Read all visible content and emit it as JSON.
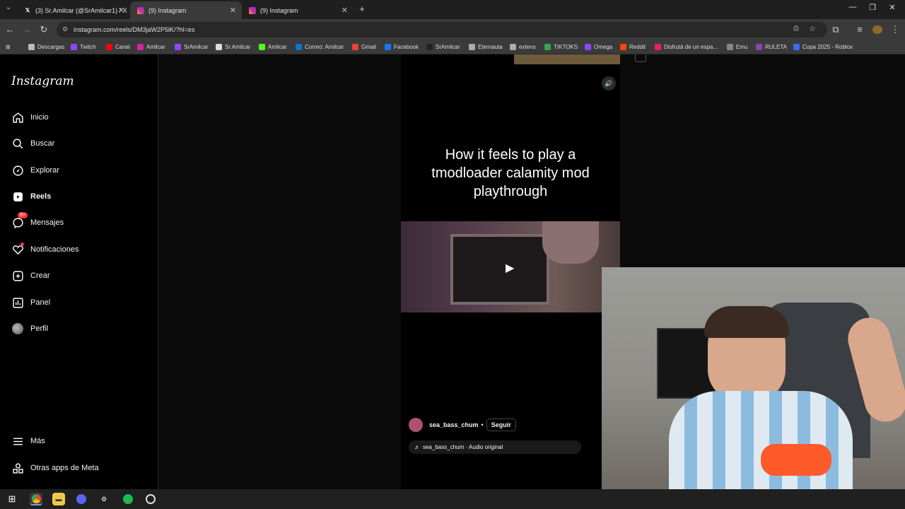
{
  "browser": {
    "tabs": [
      {
        "title": "(3) Sr.Amilcar (@SrAmilcar1) / X",
        "icon": "x-icon"
      },
      {
        "title": "(9) Instagram",
        "icon": "instagram-icon",
        "active": true
      },
      {
        "title": "(9) Instagram",
        "icon": "instagram-icon"
      }
    ],
    "url": "instagram.com/reels/DM3jaW2P5lK/?hl=es",
    "bookmarks": [
      {
        "label": "Descargas",
        "icon": "download-icon",
        "color": "#bbbbbb"
      },
      {
        "label": "Twitch",
        "icon": "twitch-icon",
        "color": "#9146ff"
      },
      {
        "label": "Canal",
        "icon": "youtube-icon",
        "color": "#ff0000"
      },
      {
        "label": "Amilcar",
        "icon": "instagram-icon",
        "color": "#d6249f"
      },
      {
        "label": "SrAmilcar",
        "icon": "twitch-icon",
        "color": "#9146ff"
      },
      {
        "label": "Sr.Amilcar",
        "icon": "x-icon",
        "color": "#dddddd"
      },
      {
        "label": "Amilcar",
        "icon": "kick-icon",
        "color": "#53fc18"
      },
      {
        "label": "Correo: Amilcar",
        "icon": "outlook-icon",
        "color": "#0078d4"
      },
      {
        "label": "Gmail",
        "icon": "gmail-icon",
        "color": "#ea4335"
      },
      {
        "label": "Facebook",
        "icon": "facebook-icon",
        "color": "#1877f2"
      },
      {
        "label": "SrAmilcar",
        "icon": "tiktok-icon",
        "color": "#222222"
      },
      {
        "label": "Eternauta",
        "icon": "doc-icon",
        "color": "#aaaaaa"
      },
      {
        "label": "extens",
        "icon": "globe-icon",
        "color": "#aaaaaa"
      },
      {
        "label": "TIKTOKS",
        "icon": "drive-icon",
        "color": "#34a853"
      },
      {
        "label": "Omega",
        "icon": "twitch-icon",
        "color": "#9146ff"
      },
      {
        "label": "Reddit",
        "icon": "reddit-icon",
        "color": "#ff4500"
      },
      {
        "label": "Disfrutá de un espa...",
        "icon": "site-icon",
        "color": "#e91e63"
      },
      {
        "label": "Emu",
        "icon": "emu-icon",
        "color": "#888888"
      },
      {
        "label": "RULETA",
        "icon": "roulette-icon",
        "color": "#8e44ad"
      },
      {
        "label": "Copa 2025 - Roblox",
        "icon": "roblox-icon",
        "color": "#3a6df0"
      }
    ]
  },
  "sidebar": {
    "logo": "Instagram",
    "items": [
      {
        "label": "Inicio",
        "icon": "home-icon"
      },
      {
        "label": "Buscar",
        "icon": "search-icon"
      },
      {
        "label": "Explorar",
        "icon": "compass-icon"
      },
      {
        "label": "Reels",
        "icon": "reels-icon",
        "active": true
      },
      {
        "label": "Mensajes",
        "icon": "messenger-icon",
        "badge": "9+"
      },
      {
        "label": "Notificaciones",
        "icon": "heart-icon"
      },
      {
        "label": "Crear",
        "icon": "plus-square-icon"
      },
      {
        "label": "Panel",
        "icon": "chart-icon"
      },
      {
        "label": "Perfil",
        "icon": "avatar-icon"
      }
    ],
    "bottom": [
      {
        "label": "Más",
        "icon": "menu-icon"
      },
      {
        "label": "Otras apps de Meta",
        "icon": "meta-apps-icon"
      }
    ]
  },
  "reel": {
    "caption": "How it feels to play a tmodloader calamity mod playthrough",
    "author": "sea_bass_chum",
    "separator": "•",
    "follow": "Seguir",
    "audio": "sea_bass_chum · Audio original"
  },
  "colors": {
    "instagram_accent": "#ff3040",
    "background": "#000000"
  }
}
